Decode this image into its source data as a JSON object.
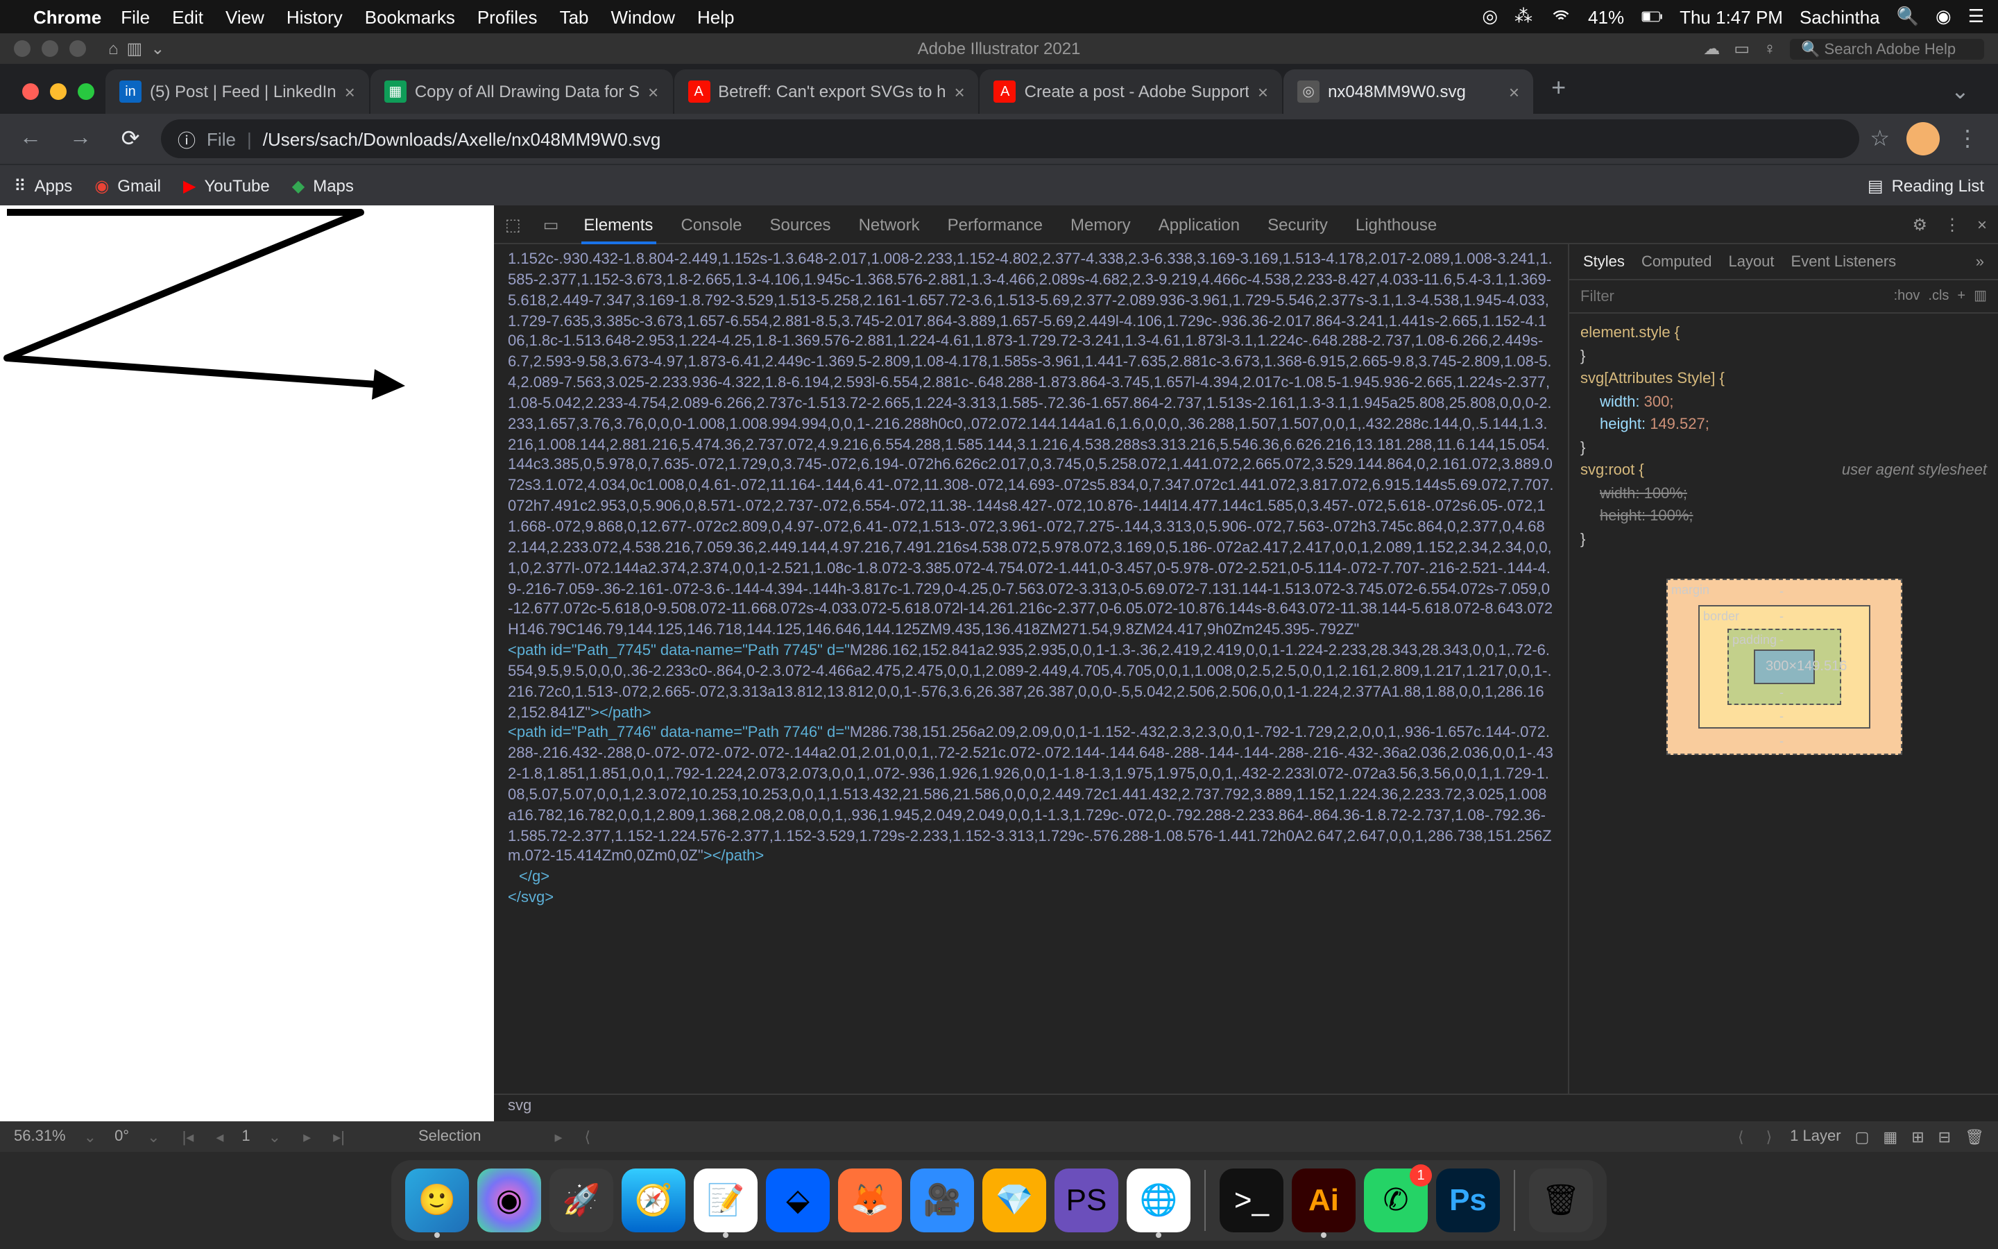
{
  "menubar": {
    "app": "Chrome",
    "items": [
      "File",
      "Edit",
      "View",
      "History",
      "Bookmarks",
      "Profiles",
      "Tab",
      "Window",
      "Help"
    ],
    "battery": "41%",
    "clock": "Thu 1:47 PM",
    "user": "Sachintha"
  },
  "ai_strip": {
    "title": "Adobe Illustrator 2021",
    "search_placeholder": "Search Adobe Help"
  },
  "tabs": [
    {
      "label": "(5) Post | Feed | LinkedIn",
      "favbg": "#0a66c2",
      "favtext": "in",
      "active": false
    },
    {
      "label": "Copy of All Drawing Data for S",
      "favbg": "#0f9d58",
      "favtext": "▦",
      "active": false
    },
    {
      "label": "Betreff: Can't export SVGs to h",
      "favbg": "#fa0f00",
      "favtext": "A",
      "active": false
    },
    {
      "label": "Create a post - Adobe Support",
      "favbg": "#fa0f00",
      "favtext": "A",
      "active": false
    },
    {
      "label": "nx048MM9W0.svg",
      "favbg": "#555",
      "favtext": "◎",
      "active": true
    }
  ],
  "address": {
    "scheme_label": "File",
    "path": "/Users/sach/Downloads/Axelle/nx048MM9W0.svg"
  },
  "bookmarks": {
    "apps": "Apps",
    "gmail": "Gmail",
    "youtube": "YouTube",
    "maps": "Maps",
    "reading": "Reading List"
  },
  "devtools": {
    "tabs": [
      "Elements",
      "Console",
      "Sources",
      "Network",
      "Performance",
      "Memory",
      "Application",
      "Security",
      "Lighthouse"
    ],
    "side_tabs": [
      "Styles",
      "Computed",
      "Layout",
      "Event Listeners"
    ],
    "filter_placeholder": "Filter",
    "hov": ":hov",
    "cls": ".cls",
    "breadcrumb": "svg",
    "styles": {
      "element_style": "element.style {",
      "svg_attr": "svg[Attributes Style] {",
      "width_prop": "width:",
      "width_val": "300;",
      "height_prop": "height:",
      "height_val": "149.527;",
      "svg_root": "svg:root {",
      "ua_label": "user agent stylesheet",
      "width100": "width: 100%;",
      "height100": "height: 100%;"
    },
    "box": {
      "margin": "margin",
      "border": "border",
      "padding": "padding",
      "content": "300×149.516"
    },
    "dom_block1": "1.152c-.930.432-1.8.804-2.449,1.152s-1.3.648-2.017,1.008-2.233,1.152-4.802,2.377-4.338,2.3-6.338,3.169-3.169,1.513-4.178,2.017-2.089,1.008-3.241,1.585-2.377,1.152-3.673,1.8-2.665,1.3-4.106,1.945c-1.368.576-2.881,1.3-4.466,2.089s-4.682,2.3-9.219,4.466c-4.538,2.233-8.427,4.033-11.6,5.4-3.1,1.369-5.618,2.449-7.347,3.169-1.8.792-3.529,1.513-5.258,2.161-1.657.72-3.6,1.513-5.69,2.377-2.089.936-3.961,1.729-5.546,2.377s-3.1,1.3-4.538,1.945-4.033,1.729-7.635,3.385c-3.673,1.657-6.554,2.881-8.5,3.745-2.017.864-3.889,1.657-5.69,2.449l-4.106,1.729c-.936.36-2.017.864-3.241,1.441s-2.665,1.152-4.106,1.8c-1.513.648-2.953,1.224-4.25,1.8-1.369.576-2.881,1.224-4.61,1.873-1.729.72-3.241,1.3-4.61,1.873l-3.1,1.224c-.648.288-2.737,1.08-6.266,2.449s-6.7,2.593-9.58,3.673-4.97,1.873-6.41,2.449c-1.369.5-2.809,1.08-4.178,1.585s-3.961,1.441-7.635,2.881c-3.673,1.368-6.915,2.665-9.8,3.745-2.809,1.08-5.4,2.089-7.563,3.025-2.233.936-4.322,1.8-6.194,2.593l-6.554,2.881c-.648.288-1.873.864-3.745,1.657l-4.394,2.017c-1.08.5-1.945.936-2.665,1.224s-2.377,1.08-5.042,2.233-4.754,2.089-6.266,2.737c-1.513.72-2.665,1.224-3.313,1.585-.72.36-1.657.864-2.737,1.513s-2.161,1.3-3.1,1.945a25.808,25.808,0,0,0-2.233,1.657,3.76,3.76,0,0,0-1.008,1.008.994.994,0,0,1-.216.288h0c0,.072.072.144.144a1.6,1.6,0,0,0,.36.288,1.507,1.507,0,0,1,.432.288c.144,0,.5.144,1.3.216,1.008.144,2.881.216,5.474.36,2.737.072,4.9.216,6.554.288,1.585.144,3.1.216,4.538.288s3.313.216,5.546.36,6.626.216,13.181.288,11.6.144,15.054.144c3.385,0,5.978,0,7.635-.072,1.729,0,3.745-.072,6.194-.072h6.626c2.017,0,3.745,0,5.258.072,1.441.072,2.665.072,3.529.144.864,0,2.161.072,3.889.072s3.1.072,4.034,0c1.008,0,4.61-.072,11.164-.144,6.41-.072,11.308-.072,14.693-.072s5.834,0,7.347.072c1.441.072,3.817.072,6.915.144s5.69.072,7.707.072h7.491c2.953,0,5.906,0,8.571-.072,2.737-.072,6.554-.072,11.38-.144s8.427-.072,10.876-.144l14.477.144c1.585,0,3.457-.072,5.618-.072s6.05-.072,11.668-.072,9.868,0,12.677-.072c2.809,0,4.97-.072,6.41-.072,1.513-.072,3.961-.072,7.275-.144,3.313,0,5.906-.072,7.563-.072h3.745c.864,0,2.377,0,4.682.144,2.233.072,4.538.216,7.059.36,2.449.144,4.97.216,7.491.216s4.538.072,5.978.072,3.169,0,5.186-.072a2.417,2.417,0,0,1,2.089,1.152,2.34,2.34,0,0,1,0,2.377l-.072.144a2.374,2.374,0,0,1-2.521,1.08c-1.8.072-3.385.072-4.754.072-1.441,0-3.457,0-5.978-.072-2.521,0-5.114-.072-7.707-.216-2.521-.144-4.9-.216-7.059-.36-2.161-.072-3.6-.144-4.394-.144h-3.817c-1.729,0-4.25,0-7.563.072-3.313,0-5.69.072-7.131.144-1.513.072-3.745.072-6.554.072s-7.059,0-12.677.072c-5.618,0-9.508.072-11.668.072s-4.033.072-5.618.072l-14.261.216c-2.377,0-6.05.072-10.876.144s-8.643.072-11.38.144-5.618.072-8.643.072H146.79C146.79,144.125,146.718,144.125,146.646,144.125ZM9.435,136.418ZM271.54,9.8ZM24.417,9h0Zm245.395-.792Z\"",
    "dom_path2_open": "<path id=\"Path_7745\" data-name=\"Path 7745\" d=\"",
    "dom_path2_d": "M286.162,152.841a2.935,2.935,0,0,1-1.3-.36,2.419,2.419,0,0,1-1.224-2.233,28.343,28.343,0,0,1,.72-6.554,9.5,9.5,0,0,0,.36-2.233c0-.864,0-2.3.072-4.466a2.475,2.475,0,0,1,2.089-2.449,4.705,4.705,0,0,1,1.008,0,2.5,2.5,0,0,1,2.161,2.809,1.217,1.217,0,0,1-.216.72c0,1.513-.072,2.665-.072,3.313a13.812,13.812,0,0,1-.576,3.6,26.387,26.387,0,0,0-.5,5.042,2.506,2.506,0,0,1-1.224,2.377A1.88,1.88,0,0,1,286.162,152.841Z\"",
    "dom_close_path": "></path>",
    "dom_path3_open": "<path id=\"Path_7746\" data-name=\"Path 7746\" d=\"",
    "dom_path3_d": "M286.738,151.256a2.09,2.09,0,0,1-1.152-.432,2.3,2.3,0,0,1-.792-1.729,2,2,0,0,1,.936-1.657c.144-.072.288-.216.432-.288,0-.072-.072-.072-.072-.144a2.01,2.01,0,0,1,.72-2.521c.072-.072.144-.144.648-.288-.144-.144-.288-.216-.432-.36a2.036,2.036,0,0,1-.432-1.8,1.851,1.851,0,0,1,.792-1.224,2.073,2.073,0,0,1,.072-.936,1.926,1.926,0,0,1-1.8-1.3,1.975,1.975,0,0,1,.432-2.233l.072-.072a3.56,3.56,0,0,1,1.729-1.08,5.07,5.07,0,0,1,2.3.072,10.253,10.253,0,0,1,1.513.432,21.586,21.586,0,0,0,2.449.72c1.441.432,2.737.792,3.889,1.152,1.224.36,2.233.72,3.025,1.008a16.782,16.782,0,0,1,2.809,1.368,2.08,2.08,0,0,1,.936,1.945,2.049,2.049,0,0,1-1.3,1.729c-.072,0-.792.288-2.233.864-.864.36-1.8.72-2.737,1.08-.792.36-1.585.72-2.377,1.152-1.224.576-2.377,1.152-3.529,1.729s-2.233,1.152-3.313,1.729c-.576.288-1.08.576-1.441.72h0A2.647,2.647,0,0,1,286.738,151.256Zm.072-15.414Zm0,0Zm0,0Z\"",
    "dom_g_close": "</g>",
    "dom_svg_close": "</svg>"
  },
  "ai_bottom": {
    "zoom": "56.31%",
    "rotate": "0°",
    "artboard": "1",
    "selection": "Selection",
    "layers": "1 Layer"
  },
  "dock": {
    "badge_whatsapp": "1"
  }
}
